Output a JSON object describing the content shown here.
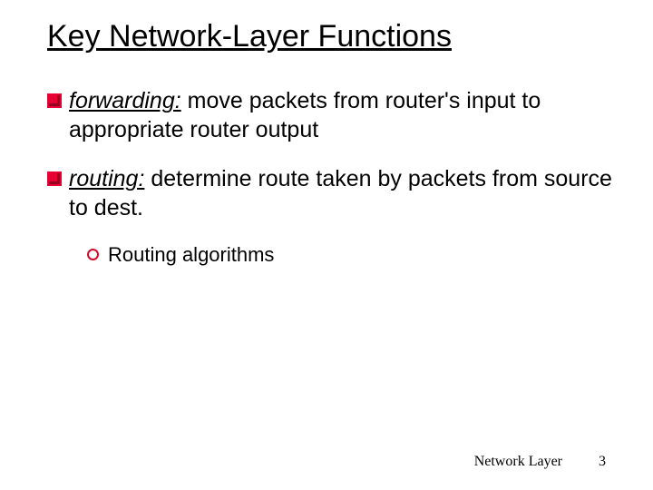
{
  "title": "Key Network-Layer Functions",
  "bullets": [
    {
      "term": "forwarding:",
      "rest": " move packets from router's input to appropriate router output"
    },
    {
      "term": "routing:",
      "rest": " determine route taken by packets from source to dest."
    }
  ],
  "sub_bullet": "Routing algorithms",
  "footer": {
    "label": "Network Layer",
    "page": "3"
  }
}
